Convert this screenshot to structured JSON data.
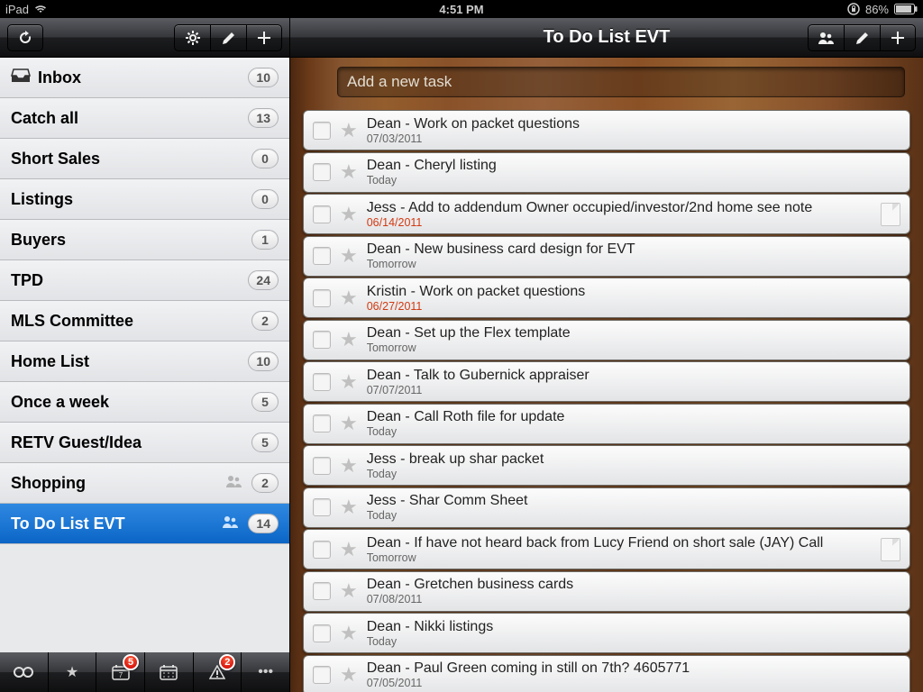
{
  "statusbar": {
    "device": "iPad",
    "time": "4:51 PM",
    "battery": "86%"
  },
  "sidebar": {
    "lists": [
      {
        "name": "Inbox",
        "count": "10",
        "has_icon": true,
        "shared": false,
        "selected": false
      },
      {
        "name": "Catch all",
        "count": "13",
        "has_icon": false,
        "shared": false,
        "selected": false
      },
      {
        "name": "Short Sales",
        "count": "0",
        "has_icon": false,
        "shared": false,
        "selected": false
      },
      {
        "name": "Listings",
        "count": "0",
        "has_icon": false,
        "shared": false,
        "selected": false
      },
      {
        "name": "Buyers",
        "count": "1",
        "has_icon": false,
        "shared": false,
        "selected": false
      },
      {
        "name": "TPD",
        "count": "24",
        "has_icon": false,
        "shared": false,
        "selected": false
      },
      {
        "name": "MLS Committee",
        "count": "2",
        "has_icon": false,
        "shared": false,
        "selected": false
      },
      {
        "name": "Home List",
        "count": "10",
        "has_icon": false,
        "shared": false,
        "selected": false
      },
      {
        "name": "Once a week",
        "count": "5",
        "has_icon": false,
        "shared": false,
        "selected": false
      },
      {
        "name": "RETV Guest/Idea",
        "count": "5",
        "has_icon": false,
        "shared": false,
        "selected": false
      },
      {
        "name": "Shopping",
        "count": "2",
        "has_icon": false,
        "shared": true,
        "selected": false
      },
      {
        "name": "To Do List EVT",
        "count": "14",
        "has_icon": false,
        "shared": true,
        "selected": true
      }
    ],
    "bottombar": {
      "calendar_badge": "5",
      "alert_badge": "2"
    }
  },
  "main": {
    "title": "To Do List EVT",
    "add_placeholder": "Add a new task",
    "tasks": [
      {
        "title": "Dean - Work on packet questions",
        "meta": "07/03/2011",
        "overdue": false,
        "has_doc": false
      },
      {
        "title": "Dean - Cheryl listing",
        "meta": "Today",
        "overdue": false,
        "has_doc": false
      },
      {
        "title": "Jess - Add to addendum Owner occupied/investor/2nd home see note",
        "meta": "06/14/2011",
        "overdue": true,
        "has_doc": true
      },
      {
        "title": "Dean - New business card design for EVT",
        "meta": "Tomorrow",
        "overdue": false,
        "has_doc": false
      },
      {
        "title": "Kristin - Work on packet questions",
        "meta": "06/27/2011",
        "overdue": true,
        "has_doc": false
      },
      {
        "title": "Dean - Set up the Flex template",
        "meta": "Tomorrow",
        "overdue": false,
        "has_doc": false
      },
      {
        "title": "Dean - Talk to Gubernick appraiser",
        "meta": "07/07/2011",
        "overdue": false,
        "has_doc": false
      },
      {
        "title": "Dean - Call Roth file for update",
        "meta": "Today",
        "overdue": false,
        "has_doc": false
      },
      {
        "title": "Jess - break up shar packet",
        "meta": "Today",
        "overdue": false,
        "has_doc": false
      },
      {
        "title": "Jess - Shar Comm Sheet",
        "meta": "Today",
        "overdue": false,
        "has_doc": false
      },
      {
        "title": "Dean - If have not heard back from Lucy Friend on short sale (JAY) Call",
        "meta": "Tomorrow",
        "overdue": false,
        "has_doc": true
      },
      {
        "title": "Dean - Gretchen business cards",
        "meta": "07/08/2011",
        "overdue": false,
        "has_doc": false
      },
      {
        "title": "Dean - Nikki listings",
        "meta": "Today",
        "overdue": false,
        "has_doc": false
      },
      {
        "title": "Dean - Paul Green coming in still on 7th? 4605771",
        "meta": "07/05/2011",
        "overdue": false,
        "has_doc": false
      }
    ]
  }
}
